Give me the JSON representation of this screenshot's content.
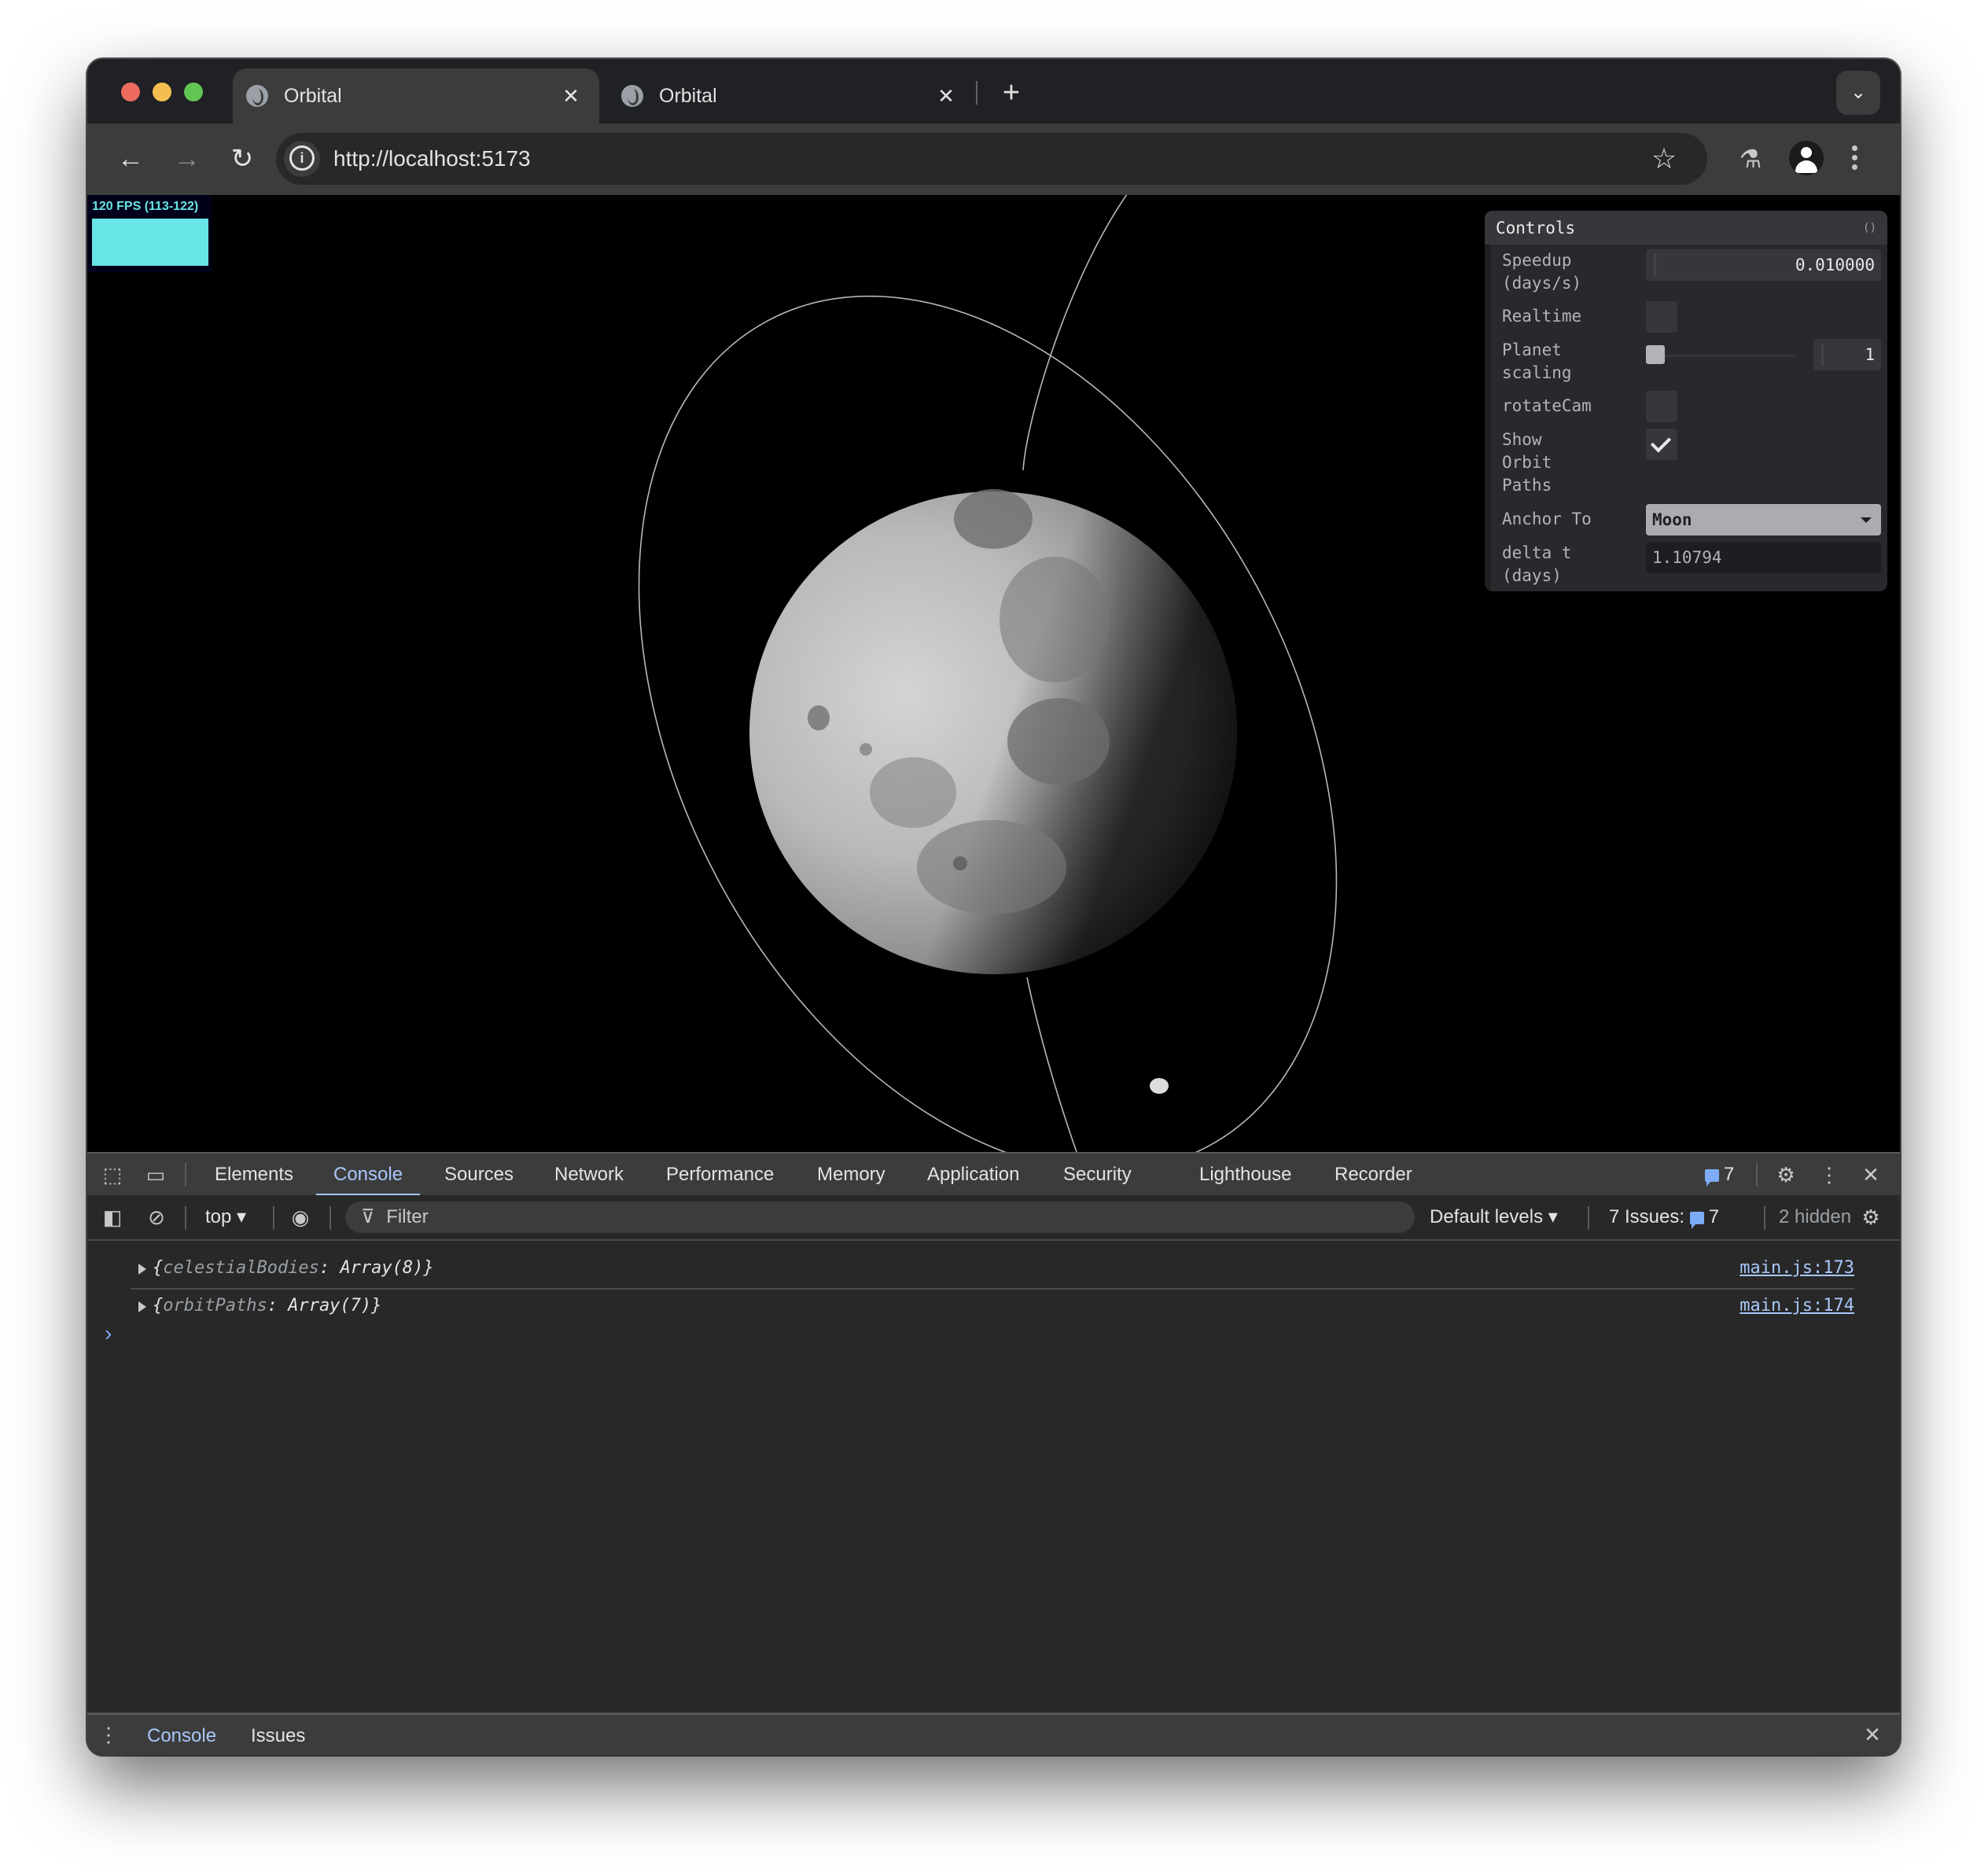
{
  "browser": {
    "tabs": [
      {
        "title": "Orbital",
        "active": true
      },
      {
        "title": "Orbital",
        "active": false
      }
    ],
    "new_tab_label": "+",
    "close_glyph": "✕",
    "url": "http://localhost:5173",
    "icons": {
      "back": "←",
      "forward": "→",
      "reload": "↻",
      "star": "☆",
      "labs": "⚗",
      "tab_search": "⌄"
    }
  },
  "viewport": {
    "fps_label": "120 FPS (113-122)",
    "scene": {
      "central_body": "Moon",
      "orbit_paths_visible": 2,
      "satellite_visible": true
    }
  },
  "controls": {
    "title": "Controls",
    "toggle_glyph": "()",
    "rows": {
      "speedup": {
        "label": "Speedup (days/s)",
        "value": "0.010000"
      },
      "realtime": {
        "label": "Realtime",
        "checked": false
      },
      "planet_scaling": {
        "label": "Planet scaling",
        "value": "1",
        "slider_fraction": 0.0
      },
      "rotate_cam": {
        "label": "rotateCam",
        "checked": false
      },
      "show_orbit_paths": {
        "label": "Show Orbit Paths",
        "checked": true
      },
      "anchor_to": {
        "label": "Anchor To",
        "value": "Moon"
      },
      "delta_t": {
        "label": "delta t (days)",
        "value": "1.10794"
      }
    }
  },
  "devtools": {
    "tabs": [
      "Elements",
      "Console",
      "Sources",
      "Network",
      "Performance",
      "Memory",
      "Application",
      "Security",
      "Lighthouse",
      "Recorder"
    ],
    "active_tab": "Console",
    "issues_badge": "7",
    "console_toolbar": {
      "context": "top",
      "filter_placeholder": "Filter",
      "levels": "Default levels",
      "issues_label": "7 Issues:",
      "issues_count": "7",
      "hidden": "2 hidden"
    },
    "logs": [
      {
        "key": "celestialBodies",
        "value": "Array(8)",
        "source": "main.js:173"
      },
      {
        "key": "orbitPaths",
        "value": "Array(7)",
        "source": "main.js:174"
      }
    ],
    "prompt_glyph": "›",
    "drawer_tabs": [
      "Console",
      "Issues"
    ],
    "drawer_active": "Console"
  },
  "colors": {
    "accent_blue": "#a8c7fa",
    "fps_cyan": "#68e5e5"
  }
}
